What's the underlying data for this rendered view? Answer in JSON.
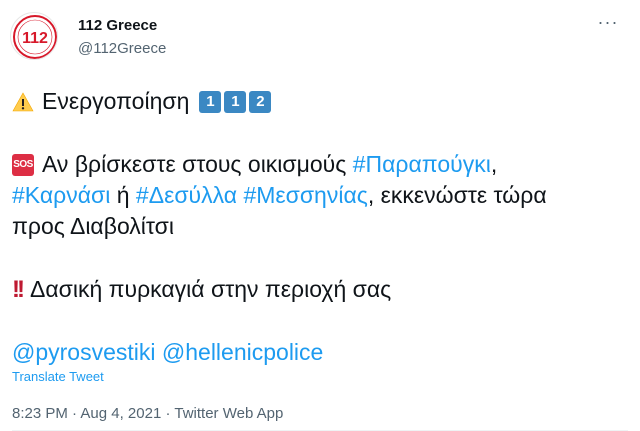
{
  "tweet": {
    "author_name": "112 Greece",
    "author_handle": "@112Greece",
    "avatar_text": "112",
    "more_label": "···",
    "line1_text": "Ενεργοποίηση",
    "line1_keys": [
      "1",
      "1",
      "2"
    ],
    "sos_label": "SOS",
    "line2_text": "Αν βρίσκεστε στους οικισμούς",
    "hashtag1": "#Παραπούγκι",
    "comma": ",",
    "hashtag2": "#Καρνάσι",
    "or_text": "ή",
    "hashtag3": "#Δεσύλλα",
    "hashtag4": "#Μεσσηνίας",
    "line3_rest": ", εκκενώστε τώρα",
    "line4_text": "προς Διαβολίτσι",
    "bang_label": "!!",
    "line5_text": "Δασική πυρκαγιά στην περιοχή σας",
    "mention1": "@pyrosvestiki",
    "mention2": "@hellenicpolice",
    "translate_label": "Translate Tweet",
    "time": "8:23 PM",
    "date": "Aug 4, 2021",
    "source": "Twitter Web App",
    "sep": "·"
  },
  "colors": {
    "link": "#1d9bf0",
    "muted": "#536471",
    "keycap": "#3b88c3",
    "sos": "#dd2e44",
    "warning": "#ffcc4d"
  }
}
